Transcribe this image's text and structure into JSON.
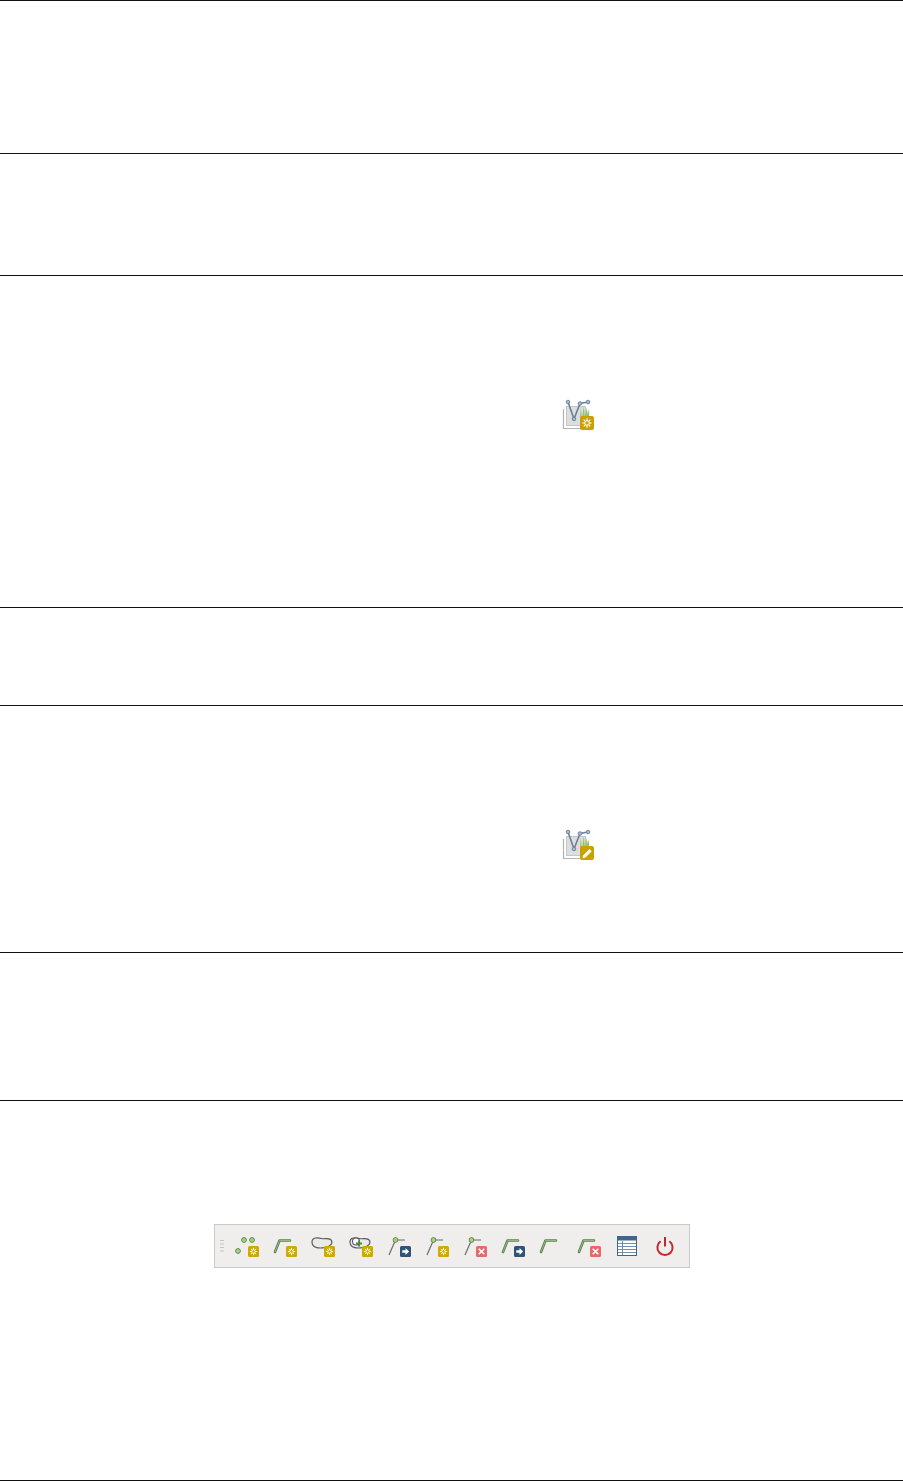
{
  "rows": [
    {
      "kind": "empty"
    },
    {
      "kind": "empty"
    },
    {
      "kind": "add_layer"
    },
    {
      "kind": "empty"
    },
    {
      "kind": "edit_layer"
    },
    {
      "kind": "empty"
    },
    {
      "kind": "toolbar",
      "buttons": [
        {
          "kind": "add_points"
        },
        {
          "kind": "add_line"
        },
        {
          "kind": "add_polygon"
        },
        {
          "kind": "add_ring"
        },
        {
          "kind": "move_vertex"
        },
        {
          "kind": "add_vertex"
        },
        {
          "kind": "delete_vertex"
        },
        {
          "kind": "move_line"
        },
        {
          "kind": "line"
        },
        {
          "kind": "delete_line"
        },
        {
          "kind": "table"
        },
        {
          "kind": "power"
        }
      ]
    }
  ]
}
